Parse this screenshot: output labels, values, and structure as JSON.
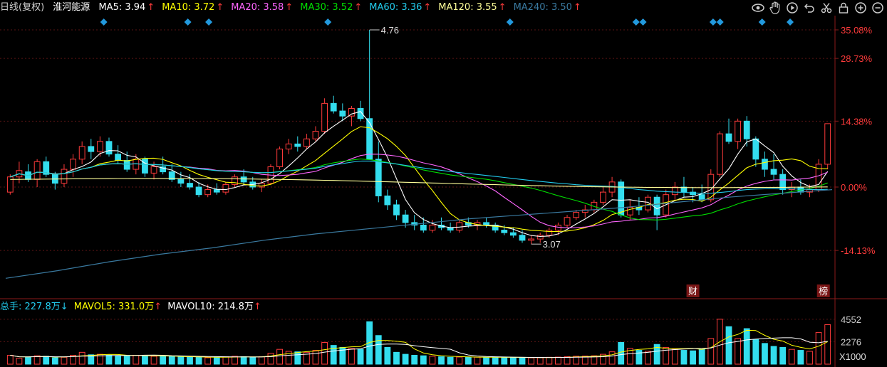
{
  "header": {
    "period_label": "日线(复权)",
    "stock_name": "淮河能源",
    "ma": [
      {
        "label": "MA5: 3.94",
        "arrow": "↑",
        "color": "#ffffff"
      },
      {
        "label": "MA10: 3.72",
        "arrow": "↑",
        "color": "#ffff00"
      },
      {
        "label": "MA20: 3.58",
        "arrow": "↑",
        "color": "#ff66ff"
      },
      {
        "label": "MA30: 3.52",
        "arrow": "↑",
        "color": "#00dd00"
      },
      {
        "label": "MA60: 3.36",
        "arrow": "↑",
        "color": "#22ccee"
      },
      {
        "label": "MA120: 3.55",
        "arrow": "↑",
        "color": "#ffff99"
      },
      {
        "label": "MA240: 3.50",
        "arrow": "↑",
        "color": "#3a7aa0"
      }
    ]
  },
  "toolbar": {
    "icons": [
      "eye-icon",
      "hand-icon",
      "play-icon",
      "undo-icon",
      "scissors-icon",
      "lock-icon",
      "zoom-in-icon",
      "zoom-out-icon"
    ]
  },
  "volume_header": {
    "total": {
      "label": "总手: 227.8万",
      "arrow": "↓",
      "color": "#22ccee"
    },
    "mavol5": {
      "label": "MAVOL5: 331.0万",
      "arrow": "↑",
      "color": "#ffff00"
    },
    "mavol10": {
      "label": "MAVOL10: 214.8万",
      "arrow": "↑",
      "color": "#ffffff"
    }
  },
  "markers": {
    "finance": "财",
    "ranking": "榜"
  },
  "colors": {
    "up": "#ff3b3b",
    "down": "#33ddee",
    "axis_pct": "#ff3b3b",
    "diamond": "#2299dd"
  },
  "chart_data": {
    "type": "candlestick",
    "price_axis": {
      "ticks": [
        {
          "label": "35.08%",
          "price": 4.76
        },
        {
          "label": "28.73%",
          "price": 4.535
        },
        {
          "label": "14.38%",
          "price": 4.04
        },
        {
          "label": "0.00%",
          "price": 3.52
        },
        {
          "label": "-14.13%",
          "price": 3.02
        }
      ],
      "range": [
        2.74,
        4.76
      ]
    },
    "max_label": "4.76",
    "min_label": "3.07",
    "volume_axis": {
      "ticks": [
        "4552",
        "2276"
      ],
      "unit": "X1000",
      "max": 4900
    },
    "candles": [
      [
        3.48,
        3.62,
        3.46,
        3.6
      ],
      [
        3.6,
        3.72,
        3.55,
        3.65
      ],
      [
        3.64,
        3.7,
        3.56,
        3.58
      ],
      [
        3.58,
        3.74,
        3.52,
        3.72
      ],
      [
        3.72,
        3.76,
        3.6,
        3.62
      ],
      [
        3.62,
        3.64,
        3.5,
        3.55
      ],
      [
        3.55,
        3.7,
        3.52,
        3.66
      ],
      [
        3.66,
        3.78,
        3.6,
        3.74
      ],
      [
        3.74,
        3.88,
        3.7,
        3.84
      ],
      [
        3.84,
        3.9,
        3.74,
        3.8
      ],
      [
        3.8,
        3.92,
        3.76,
        3.88
      ],
      [
        3.88,
        3.91,
        3.76,
        3.78
      ],
      [
        3.78,
        3.85,
        3.7,
        3.73
      ],
      [
        3.73,
        3.8,
        3.64,
        3.66
      ],
      [
        3.66,
        3.78,
        3.62,
        3.74
      ],
      [
        3.74,
        3.76,
        3.6,
        3.63
      ],
      [
        3.63,
        3.72,
        3.58,
        3.68
      ],
      [
        3.68,
        3.76,
        3.62,
        3.64
      ],
      [
        3.64,
        3.7,
        3.56,
        3.58
      ],
      [
        3.58,
        3.64,
        3.52,
        3.55
      ],
      [
        3.55,
        3.62,
        3.5,
        3.52
      ],
      [
        3.52,
        3.56,
        3.44,
        3.46
      ],
      [
        3.46,
        3.54,
        3.44,
        3.5
      ],
      [
        3.5,
        3.55,
        3.46,
        3.48
      ],
      [
        3.48,
        3.56,
        3.46,
        3.54
      ],
      [
        3.54,
        3.62,
        3.52,
        3.6
      ],
      [
        3.6,
        3.66,
        3.54,
        3.56
      ],
      [
        3.56,
        3.6,
        3.5,
        3.52
      ],
      [
        3.52,
        3.58,
        3.48,
        3.55
      ],
      [
        3.55,
        3.7,
        3.54,
        3.68
      ],
      [
        3.68,
        3.84,
        3.66,
        3.82
      ],
      [
        3.82,
        3.9,
        3.78,
        3.86
      ],
      [
        3.86,
        3.92,
        3.8,
        3.84
      ],
      [
        3.84,
        3.94,
        3.82,
        3.9
      ],
      [
        3.9,
        4.0,
        3.88,
        3.96
      ],
      [
        3.96,
        4.22,
        3.94,
        4.18
      ],
      [
        4.18,
        4.24,
        4.1,
        4.12
      ],
      [
        4.12,
        4.18,
        4.04,
        4.08
      ],
      [
        4.08,
        4.16,
        4.0,
        4.14
      ],
      [
        4.14,
        4.2,
        4.04,
        4.06
      ],
      [
        4.06,
        4.76,
        4.04,
        3.74
      ],
      [
        3.74,
        3.88,
        3.4,
        3.45
      ],
      [
        3.45,
        3.5,
        3.34,
        3.38
      ],
      [
        3.38,
        3.42,
        3.26,
        3.3
      ],
      [
        3.3,
        3.34,
        3.2,
        3.24
      ],
      [
        3.24,
        3.3,
        3.18,
        3.22
      ],
      [
        3.22,
        3.28,
        3.16,
        3.18
      ],
      [
        3.18,
        3.26,
        3.16,
        3.22
      ],
      [
        3.22,
        3.28,
        3.18,
        3.2
      ],
      [
        3.2,
        3.24,
        3.16,
        3.18
      ],
      [
        3.18,
        3.26,
        3.16,
        3.24
      ],
      [
        3.24,
        3.28,
        3.2,
        3.22
      ],
      [
        3.22,
        3.26,
        3.18,
        3.24
      ],
      [
        3.24,
        3.28,
        3.2,
        3.22
      ],
      [
        3.22,
        3.24,
        3.16,
        3.18
      ],
      [
        3.18,
        3.22,
        3.14,
        3.16
      ],
      [
        3.16,
        3.2,
        3.12,
        3.14
      ],
      [
        3.14,
        3.18,
        3.08,
        3.1
      ],
      [
        3.1,
        3.14,
        3.07,
        3.11
      ],
      [
        3.11,
        3.16,
        3.08,
        3.14
      ],
      [
        3.14,
        3.2,
        3.12,
        3.18
      ],
      [
        3.18,
        3.24,
        3.14,
        3.22
      ],
      [
        3.22,
        3.3,
        3.2,
        3.28
      ],
      [
        3.28,
        3.34,
        3.26,
        3.32
      ],
      [
        3.32,
        3.38,
        3.28,
        3.34
      ],
      [
        3.34,
        3.42,
        3.32,
        3.4
      ],
      [
        3.4,
        3.52,
        3.38,
        3.48
      ],
      [
        3.48,
        3.6,
        3.44,
        3.56
      ],
      [
        3.56,
        3.58,
        3.28,
        3.3
      ],
      [
        3.3,
        3.42,
        3.26,
        3.36
      ],
      [
        3.36,
        3.44,
        3.3,
        3.34
      ],
      [
        3.34,
        3.46,
        3.32,
        3.44
      ],
      [
        3.44,
        3.46,
        3.18,
        3.3
      ],
      [
        3.3,
        3.5,
        3.28,
        3.46
      ],
      [
        3.46,
        3.56,
        3.42,
        3.52
      ],
      [
        3.52,
        3.6,
        3.44,
        3.48
      ],
      [
        3.48,
        3.52,
        3.4,
        3.46
      ],
      [
        3.46,
        3.54,
        3.4,
        3.42
      ],
      [
        3.42,
        3.66,
        3.4,
        3.62
      ],
      [
        3.62,
        3.96,
        3.6,
        3.94
      ],
      [
        3.94,
        4.06,
        3.86,
        3.88
      ],
      [
        3.88,
        4.06,
        3.82,
        4.04
      ],
      [
        4.04,
        4.08,
        3.84,
        3.9
      ],
      [
        3.9,
        3.92,
        3.68,
        3.74
      ],
      [
        3.74,
        3.8,
        3.6,
        3.66
      ],
      [
        3.66,
        3.78,
        3.58,
        3.62
      ],
      [
        3.62,
        3.66,
        3.46,
        3.5
      ],
      [
        3.5,
        3.56,
        3.44,
        3.52
      ],
      [
        3.52,
        3.58,
        3.46,
        3.48
      ],
      [
        3.48,
        3.54,
        3.44,
        3.5
      ],
      [
        3.5,
        3.74,
        3.48,
        3.7
      ],
      [
        3.7,
        3.98,
        3.66,
        4.02
      ]
    ],
    "volumes": [
      900,
      600,
      700,
      850,
      800,
      650,
      700,
      900,
      1200,
      950,
      1000,
      900,
      850,
      800,
      900,
      850,
      800,
      780,
      760,
      750,
      700,
      720,
      650,
      700,
      750,
      800,
      760,
      700,
      750,
      1100,
      1500,
      1300,
      1250,
      1200,
      1400,
      2200,
      1900,
      1700,
      1600,
      1500,
      4300,
      2900,
      1700,
      1200,
      1000,
      900,
      850,
      800,
      750,
      700,
      720,
      690,
      710,
      680,
      700,
      690,
      680,
      660,
      640,
      650,
      700,
      720,
      760,
      800,
      820,
      850,
      1000,
      1250,
      2200,
      1600,
      1400,
      1300,
      2000,
      1700,
      1500,
      1400,
      1350,
      1500,
      2600,
      4552,
      3800,
      2600,
      3600,
      2500,
      2100,
      1800,
      1700,
      1500,
      1400,
      1300,
      3200,
      4000
    ],
    "ma_series": [
      {
        "name": "MA5",
        "color": "#ffffff"
      },
      {
        "name": "MA10",
        "color": "#ffff00"
      },
      {
        "name": "MA20",
        "color": "#ff66ff"
      },
      {
        "name": "MA30",
        "color": "#00dd00"
      },
      {
        "name": "MA60",
        "color": "#22ccee"
      },
      {
        "name": "MA120",
        "color": "#ffff99"
      },
      {
        "name": "MA240",
        "color": "#3a7aa0"
      }
    ],
    "ma240_path_prices": [
      2.8,
      2.86,
      2.93,
      2.99,
      3.04,
      3.1,
      3.15,
      3.19,
      3.23,
      3.27,
      3.3,
      3.33,
      3.36,
      3.4,
      3.44,
      3.47,
      3.5
    ]
  }
}
